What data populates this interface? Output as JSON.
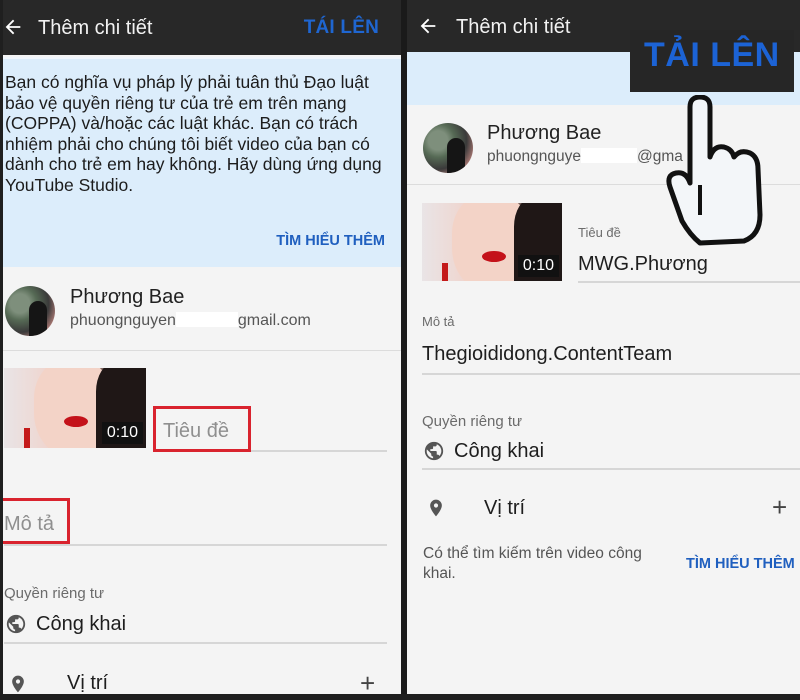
{
  "left": {
    "appbar": {
      "title": "Thêm chi tiết",
      "upload_label": "TÁI LÊN"
    },
    "notice": {
      "text": "Bạn có nghĩa vụ pháp lý phải tuân thủ Đạo luật bảo vệ quyền riêng tư của trẻ em trên mạng (COPPA) và/hoặc các luật khác. Bạn có trách nhiệm phải cho chúng tôi biết video của bạn có dành cho trẻ em hay không. Hãy dùng ứng dụng YouTube Studio.",
      "learn_more": "TÌM HIỂU THÊM"
    },
    "account": {
      "name": "Phương Bae",
      "email_prefix": "phuongnguyen",
      "email_suffix": "gmail.com"
    },
    "video": {
      "duration": "0:10"
    },
    "title_field": {
      "placeholder": "Tiêu đề",
      "value": ""
    },
    "description_field": {
      "placeholder": "Mô tả",
      "value": ""
    },
    "privacy": {
      "label": "Quyền riêng tư",
      "value": "Công khai"
    },
    "location": {
      "label": "Vị trí",
      "add": "+"
    }
  },
  "right": {
    "appbar": {
      "title": "Thêm chi tiết",
      "upload_label": "TẢI LÊN"
    },
    "account": {
      "name": "Phương Bae",
      "email_prefix": "phuongnguye",
      "email_suffix": "@gma"
    },
    "video": {
      "duration": "0:10"
    },
    "title_field": {
      "label": "Tiêu đề",
      "value": "MWG.Phương"
    },
    "description_field": {
      "label": "Mô tả",
      "value": "Thegioididong.ContentTeam"
    },
    "privacy": {
      "label": "Quyền riêng tư",
      "value": "Công khai"
    },
    "location": {
      "label": "Vị trí",
      "add": "+"
    },
    "searchable_hint": "Có thể tìm kiếm trên video công khai.",
    "learn_more": "TÌM HIỂU THÊM"
  },
  "colors": {
    "accent": "#1f66d1",
    "highlight": "#d9232e",
    "appbar": "#282828",
    "notice_bg": "#dcedfb"
  }
}
